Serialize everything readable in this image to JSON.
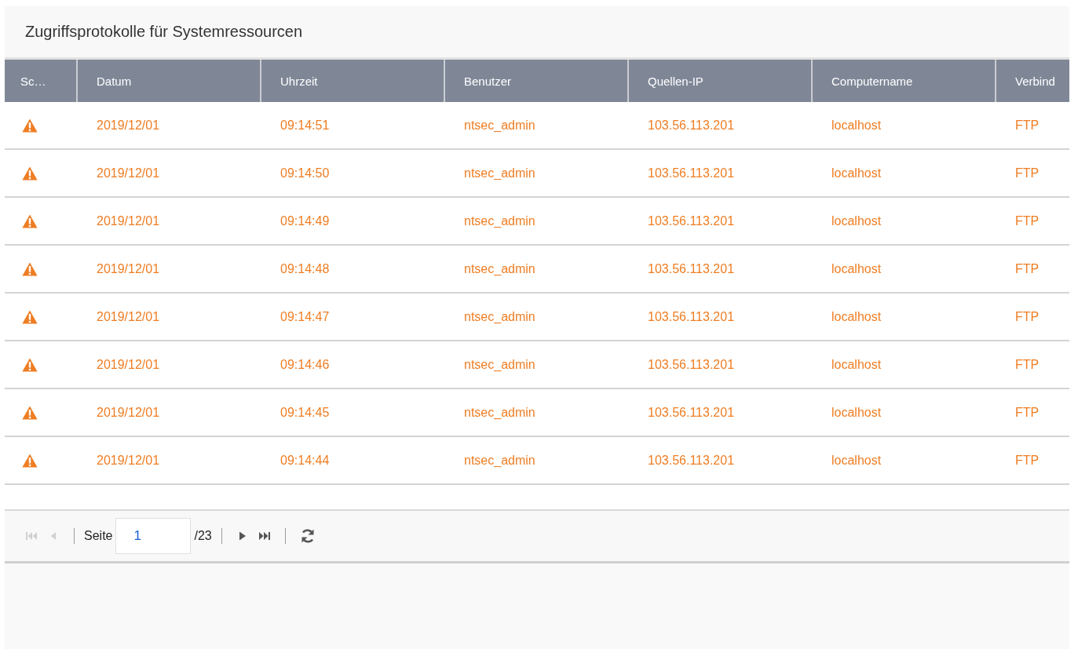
{
  "panel": {
    "title": "Zugriffsprotokolle für Systemressourcen"
  },
  "table": {
    "columns": [
      "Sc…",
      "Datum",
      "Uhrzeit",
      "Benutzer",
      "Quellen-IP",
      "Computername",
      "Verbind"
    ],
    "rows": [
      {
        "kind": "warning",
        "cells": [
          "",
          "2019/12/01",
          "09:14:51",
          "ntsec_admin",
          "103.56.113.201",
          "localhost",
          "FTP"
        ]
      },
      {
        "kind": "warning",
        "cells": [
          "",
          "2019/12/01",
          "09:14:50",
          "ntsec_admin",
          "103.56.113.201",
          "localhost",
          "FTP"
        ]
      },
      {
        "kind": "warning",
        "cells": [
          "",
          "2019/12/01",
          "09:14:49",
          "ntsec_admin",
          "103.56.113.201",
          "localhost",
          "FTP"
        ]
      },
      {
        "kind": "warning",
        "cells": [
          "",
          "2019/12/01",
          "09:14:48",
          "ntsec_admin",
          "103.56.113.201",
          "localhost",
          "FTP"
        ]
      },
      {
        "kind": "warning",
        "cells": [
          "",
          "2019/12/01",
          "09:14:47",
          "ntsec_admin",
          "103.56.113.201",
          "localhost",
          "FTP"
        ]
      },
      {
        "kind": "warning",
        "cells": [
          "",
          "2019/12/01",
          "09:14:46",
          "ntsec_admin",
          "103.56.113.201",
          "localhost",
          "FTP"
        ]
      },
      {
        "kind": "warning",
        "cells": [
          "",
          "2019/12/01",
          "09:14:45",
          "ntsec_admin",
          "103.56.113.201",
          "localhost",
          "FTP"
        ]
      },
      {
        "kind": "warning",
        "cells": [
          "",
          "2019/12/01",
          "09:14:44",
          "ntsec_admin",
          "103.56.113.201",
          "localhost",
          "FTP"
        ]
      }
    ]
  },
  "pager": {
    "first": {
      "disabled": true
    },
    "prev": {
      "disabled": true
    },
    "label": "Seite",
    "page": "1",
    "total": "/23",
    "next": {
      "disabled": false
    },
    "last": {
      "disabled": false
    }
  }
}
